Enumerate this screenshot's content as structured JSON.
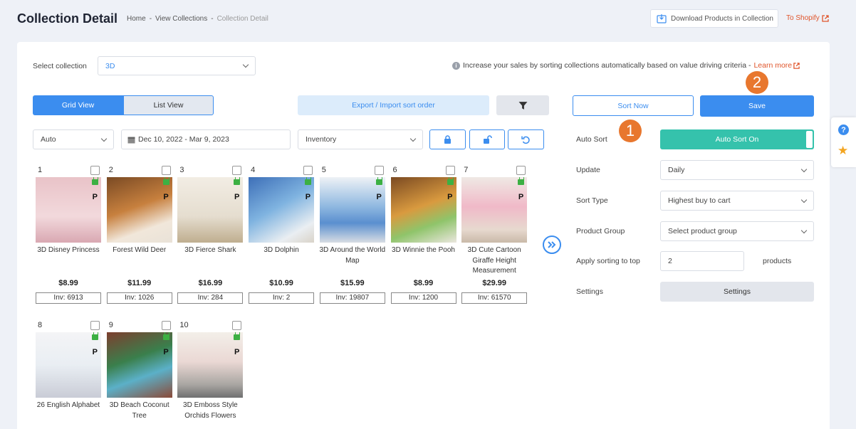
{
  "header": {
    "title": "Collection Detail",
    "breadcrumb": {
      "home": "Home",
      "sep": "-",
      "view": "View Collections",
      "current": "Collection Detail"
    },
    "download_label": "Download Products in Collection",
    "shopify_label": "To Shopify"
  },
  "collection": {
    "label": "Select collection",
    "value": "3D"
  },
  "info": {
    "text": "Increase your sales by sorting collections automatically based on value driving criteria - ",
    "link": "Learn more"
  },
  "toolbar": {
    "grid_view": "Grid View",
    "list_view": "List View",
    "export_label": "Export / Import sort order"
  },
  "filters": {
    "mode": "Auto",
    "date_range": "Dec 10, 2022 - Mar 9, 2023",
    "metric": "Inventory"
  },
  "actions": {
    "sort_now": "Sort Now",
    "save": "Save"
  },
  "badges": {
    "one": "1",
    "two": "2"
  },
  "settings_panel": {
    "auto_sort_label": "Auto Sort",
    "auto_sort_value": "Auto Sort On",
    "update_label": "Update",
    "update_value": "Daily",
    "sort_type_label": "Sort Type",
    "sort_type_value": "Highest buy to cart",
    "product_group_label": "Product Group",
    "product_group_value": "Select product group",
    "apply_top_label": "Apply sorting to top",
    "apply_top_value": "2",
    "apply_top_suffix": "products",
    "settings_label": "Settings",
    "settings_button": "Settings"
  },
  "products": [
    {
      "num": "1",
      "name": "3D Disney Princess",
      "price": "$8.99",
      "inv": "Inv: 6913"
    },
    {
      "num": "2",
      "name": "Forest Wild Deer",
      "price": "$11.99",
      "inv": "Inv: 1026"
    },
    {
      "num": "3",
      "name": "3D Fierce Shark",
      "price": "$16.99",
      "inv": "Inv: 284"
    },
    {
      "num": "4",
      "name": "3D Dolphin",
      "price": "$10.99",
      "inv": "Inv: 2"
    },
    {
      "num": "5",
      "name": "3D Around the World Map",
      "price": "$15.99",
      "inv": "Inv: 19807"
    },
    {
      "num": "6",
      "name": "3D Winnie the Pooh",
      "price": "$8.99",
      "inv": "Inv: 1200"
    },
    {
      "num": "7",
      "name": "3D Cute Cartoon Giraffe Height Measurement",
      "price": "$29.99",
      "inv": "Inv: 61570"
    },
    {
      "num": "8",
      "name": "26 English Alphabet",
      "price": "",
      "inv": ""
    },
    {
      "num": "9",
      "name": "3D Beach Coconut Tree",
      "price": "",
      "inv": ""
    },
    {
      "num": "10",
      "name": "3D Emboss Style Orchids Flowers",
      "price": "",
      "inv": ""
    }
  ],
  "product_badge": "P",
  "colors": {
    "primary": "#3b8def",
    "teal": "#35c2ac",
    "orange": "#e8772e",
    "link": "#e0552b"
  }
}
